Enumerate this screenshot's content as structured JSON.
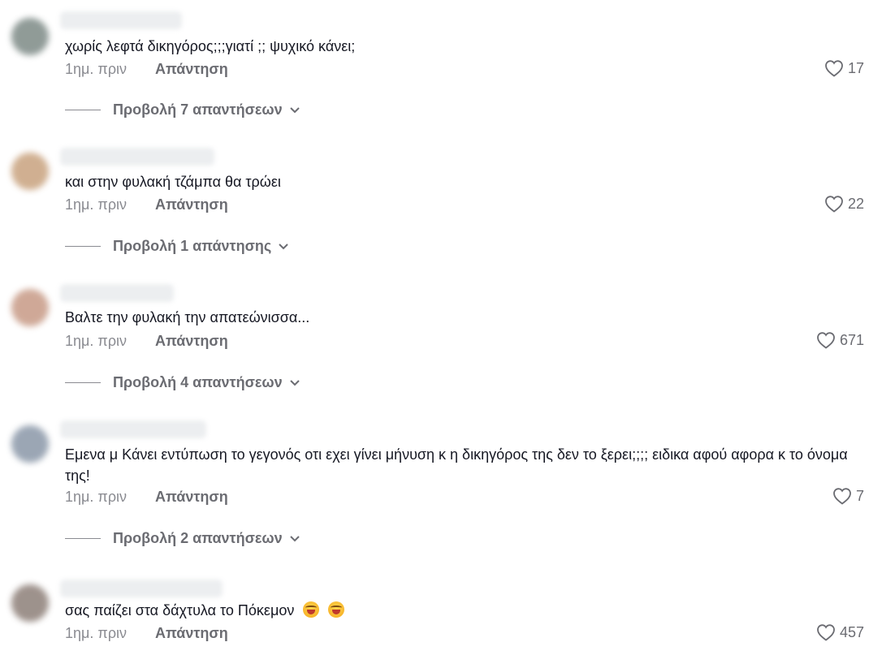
{
  "comments": [
    {
      "text": "χωρίς λεφτά δικηγόρος;;;γιατί ;; ψυχικό κάνει;",
      "time": "1ημ. πριν",
      "reply_label": "Απάντηση",
      "likes": "17",
      "view_replies": "Προβολή 7 απαντήσεων",
      "avatar_color": "#7d8a86"
    },
    {
      "text": "και στην φυλακή τζάμπα θα τρώει",
      "time": "1ημ. πριν",
      "reply_label": "Απάντηση",
      "likes": "22",
      "view_replies": "Προβολή 1 απάντησης",
      "avatar_color": "#c8a27e"
    },
    {
      "text": "Βαλτε την φυλακή την απατεώνισσα...",
      "time": "1ημ. πριν",
      "reply_label": "Απάντηση",
      "likes": "671",
      "view_replies": "Προβολή 4 απαντήσεων",
      "avatar_color": "#c79a86"
    },
    {
      "text": "Εμενα μ Κάνει εντύπωση το γεγονός οτι εχει γίνει μήνυση κ η δικηγόρος της δεν το ξερει;;;; ειδικα αφού αφορα κ το όνομα της!",
      "time": "1ημ. πριν",
      "reply_label": "Απάντηση",
      "likes": "7",
      "view_replies": "Προβολή 2 απαντήσεων",
      "avatar_color": "#8a97a8"
    },
    {
      "text": "σας παίζει στα δάχτυλα το Πόκεμον",
      "emoji_count": 2,
      "time": "1ημ. πριν",
      "reply_label": "Απάντηση",
      "likes": "457",
      "view_replies": "",
      "avatar_color": "#8d7f78"
    }
  ]
}
